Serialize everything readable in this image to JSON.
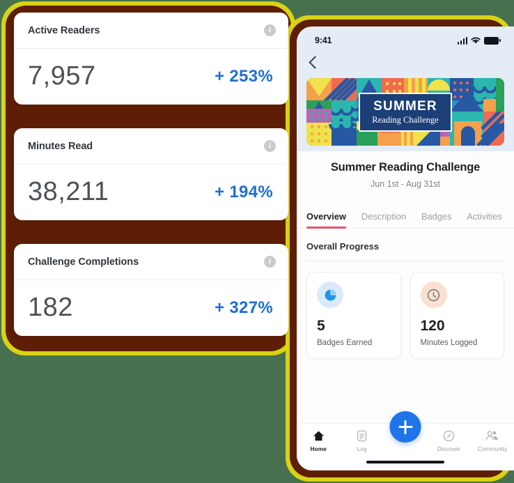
{
  "background_color": "#47704f",
  "accent_blue": "#1f6fd4",
  "frame": {
    "glow_color": "#d8d313",
    "border_color": "#5e1e06"
  },
  "dashboard": {
    "cards": [
      {
        "title": "Active Readers",
        "value": "7,957",
        "delta": "+ 253%",
        "info": "i"
      },
      {
        "title": "Minutes Read",
        "value": "38,211",
        "delta": "+ 194%",
        "info": "i"
      },
      {
        "title": "Challenge Completions",
        "value": "182",
        "delta": "+ 327%",
        "info": "i"
      }
    ]
  },
  "phone": {
    "status": {
      "time": "9:41",
      "signal_icon": "cellular-bars-icon",
      "wifi_icon": "wifi-icon",
      "battery_icon": "battery-full-icon"
    },
    "back_icon": "chevron-left-icon",
    "banner": {
      "line1": "SUMMER",
      "line2": "Reading Challenge",
      "image_name": "summer-reading-banner"
    },
    "challenge": {
      "title": "Summer Reading Challenge",
      "dates": "Jun 1st - Aug 31st"
    },
    "tabs": [
      {
        "label": "Overview",
        "active": true
      },
      {
        "label": "Description",
        "active": false
      },
      {
        "label": "Badges",
        "active": false
      },
      {
        "label": "Activities",
        "active": false
      }
    ],
    "progress": {
      "heading": "Overall Progress",
      "cards": [
        {
          "value": "5",
          "label": "Badges Earned",
          "icon": "badge-droplet-icon",
          "icon_bg": "#dbeaf9",
          "icon_color": "#1f94e8"
        },
        {
          "value": "120",
          "label": "Minutes Logged",
          "icon": "clock-icon",
          "icon_bg": "#fbdfd1",
          "icon_color": "#6b7279"
        }
      ]
    },
    "bottom_nav": [
      {
        "label": "Home",
        "icon": "home-icon",
        "active": true
      },
      {
        "label": "Log",
        "icon": "log-icon",
        "active": false
      },
      {
        "label": "Discover",
        "icon": "compass-icon",
        "active": false
      },
      {
        "label": "Community",
        "icon": "people-icon",
        "active": false
      }
    ],
    "fab": {
      "icon": "plus-icon",
      "color": "#1f74e8"
    }
  }
}
